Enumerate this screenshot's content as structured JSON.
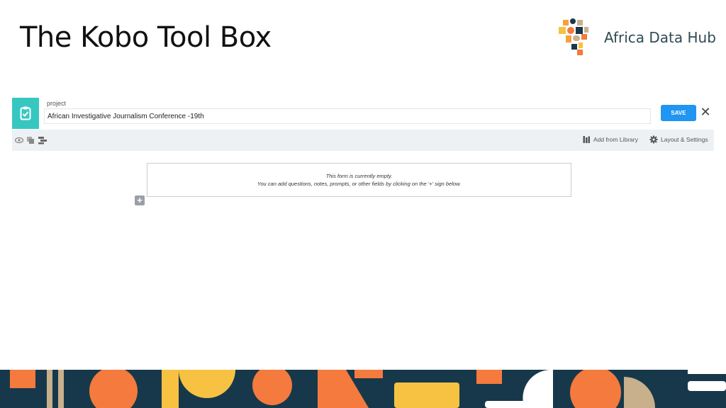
{
  "slide": {
    "title": "The Kobo Tool Box"
  },
  "logo": {
    "text": "Africa Data Hub"
  },
  "kobo": {
    "project_label": "project",
    "project_name": "African Investigative Journalism Conference -19th",
    "save_label": "SAVE",
    "close_symbol": "✕",
    "toolbar": {
      "add_from_library": "Add from Library",
      "layout_settings": "Layout & Settings"
    },
    "empty_form": {
      "line1": "This form is currently empty.",
      "line2": "You can add questions, notes, prompts, or other fields by clicking on the '+' sign below."
    },
    "add_symbol": "+"
  },
  "colors": {
    "teal": "#37c7c0",
    "save_blue": "#2095f2",
    "band_navy": "#17384a",
    "orange": "#f47a3d",
    "yellow": "#f7c242",
    "tan": "#c9b08c"
  }
}
